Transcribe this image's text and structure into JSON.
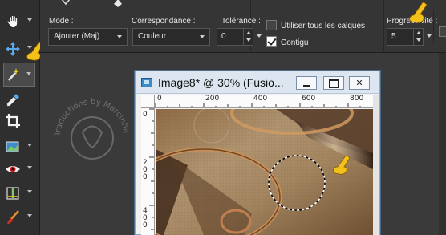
{
  "toolbar": {
    "tools": [
      {
        "name": "pan-tool",
        "icon": "hand-icon"
      },
      {
        "name": "move-tool",
        "icon": "move-arrows-icon"
      },
      {
        "name": "magic-wand-tool",
        "icon": "magic-wand-icon",
        "active": true
      },
      {
        "name": "dropper-tool",
        "icon": "dropper-icon"
      },
      {
        "name": "crop-tool",
        "icon": "crop-icon"
      },
      {
        "name": "picture-tube-tool",
        "icon": "picture-tube-icon"
      },
      {
        "name": "red-eye-tool",
        "icon": "eye-icon"
      },
      {
        "name": "straighten-tool",
        "icon": "straighten-icon"
      },
      {
        "name": "brush-tool",
        "icon": "brush-icon"
      }
    ]
  },
  "options": {
    "mode_label": "Mode :",
    "mode_value": "Ajouter (Maj)",
    "match_label": "Correspondance :",
    "match_value": "Couleur",
    "tolerance_label": "Tolérance :",
    "tolerance_value": "0",
    "use_all_layers_label": "Utiliser tous les calques",
    "use_all_layers_checked": false,
    "contiguous_label": "Contigu",
    "contiguous_checked": true,
    "progressive_label": "Progressivité :",
    "progressive_value": "5"
  },
  "watermark": {
    "text": "Traductions by Marcinha - SIM - PSP"
  },
  "image_window": {
    "title": "Image8* @  30% (Fusio...",
    "hruler_ticks": [
      "0",
      "200",
      "400",
      "600",
      "800"
    ],
    "vruler_ticks": [
      "0",
      "2",
      "0",
      "0",
      "4",
      "0",
      "0"
    ]
  },
  "colors": {
    "panel_bg": "#353535",
    "toolbar_bg": "#2f2f2f",
    "workspace_bg": "#3a3a3a",
    "title_bar_bg": "#dde6f0",
    "pointer_yellow": "#f2c21b",
    "canvas_tan": "#a38560"
  }
}
